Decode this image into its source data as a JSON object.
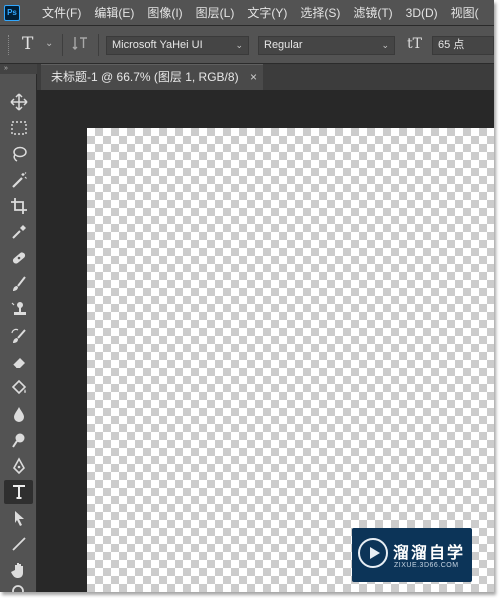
{
  "app": {
    "logo_text": "Ps"
  },
  "menubar": {
    "items": [
      "文件(F)",
      "编辑(E)",
      "图像(I)",
      "图层(L)",
      "文字(Y)",
      "选择(S)",
      "滤镜(T)",
      "3D(D)",
      "视图("
    ]
  },
  "options": {
    "tool_glyph": "T",
    "tool_menu": "⌄",
    "font_family": "Microsoft YaHei UI",
    "font_style": "Regular",
    "size_icon": "tT",
    "font_size": "65 点",
    "dropdown_glyph": "⌄"
  },
  "panel": {
    "collapse_glyph": "»"
  },
  "document": {
    "tab_title": "未标题-1 @ 66.7% (图层 1, RGB/8)",
    "close_glyph": "×"
  },
  "watermark": {
    "title": "溜溜自学",
    "subtitle": "ZIXUE.3D66.COM"
  },
  "toolbar": {
    "active_tool": "type-tool",
    "tools": [
      "move",
      "marquee",
      "lasso",
      "magic-wand",
      "crop",
      "eyedropper",
      "healing-brush",
      "brush",
      "clone-stamp",
      "history-brush",
      "eraser",
      "paint-bucket",
      "blur",
      "dodge",
      "pen",
      "type",
      "path-selection",
      "line",
      "hand",
      "zoom"
    ]
  },
  "colors": {
    "chrome": "#535353",
    "workspace": "#282828",
    "tab_bar": "#3c3c3c",
    "accent_ps": "#31a8ff",
    "watermark_bg": "#0c3458"
  }
}
